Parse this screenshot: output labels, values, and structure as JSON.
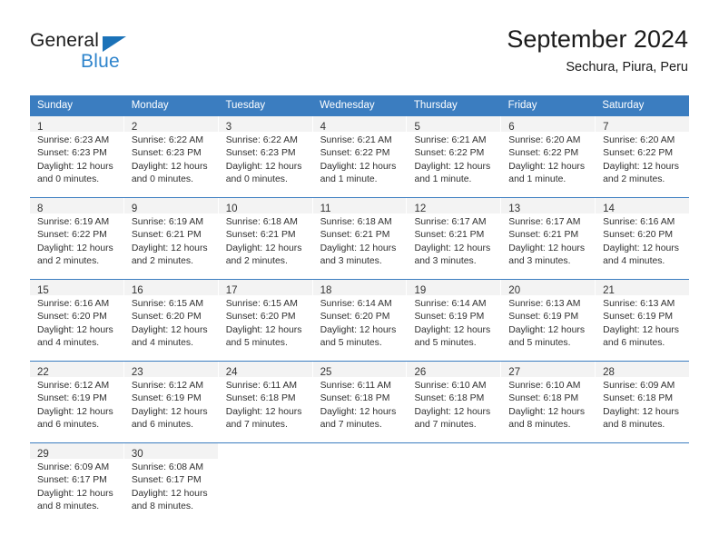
{
  "brand": {
    "name_top": "General",
    "name_bottom": "Blue",
    "accent_color": "#2e84cc",
    "triangle_color": "#1b72b8"
  },
  "header": {
    "title": "September 2024",
    "subtitle": "Sechura, Piura, Peru"
  },
  "theme": {
    "header_row_bg": "#3b7dc0",
    "header_row_text": "#ffffff",
    "daynum_band_bg": "#f3f3f3",
    "week_border": "#3b7dc0"
  },
  "weekdays": [
    "Sunday",
    "Monday",
    "Tuesday",
    "Wednesday",
    "Thursday",
    "Friday",
    "Saturday"
  ],
  "weeks": [
    [
      {
        "day": "1",
        "sunrise": "Sunrise: 6:23 AM",
        "sunset": "Sunset: 6:23 PM",
        "daylight1": "Daylight: 12 hours",
        "daylight2": "and 0 minutes."
      },
      {
        "day": "2",
        "sunrise": "Sunrise: 6:22 AM",
        "sunset": "Sunset: 6:23 PM",
        "daylight1": "Daylight: 12 hours",
        "daylight2": "and 0 minutes."
      },
      {
        "day": "3",
        "sunrise": "Sunrise: 6:22 AM",
        "sunset": "Sunset: 6:23 PM",
        "daylight1": "Daylight: 12 hours",
        "daylight2": "and 0 minutes."
      },
      {
        "day": "4",
        "sunrise": "Sunrise: 6:21 AM",
        "sunset": "Sunset: 6:22 PM",
        "daylight1": "Daylight: 12 hours",
        "daylight2": "and 1 minute."
      },
      {
        "day": "5",
        "sunrise": "Sunrise: 6:21 AM",
        "sunset": "Sunset: 6:22 PM",
        "daylight1": "Daylight: 12 hours",
        "daylight2": "and 1 minute."
      },
      {
        "day": "6",
        "sunrise": "Sunrise: 6:20 AM",
        "sunset": "Sunset: 6:22 PM",
        "daylight1": "Daylight: 12 hours",
        "daylight2": "and 1 minute."
      },
      {
        "day": "7",
        "sunrise": "Sunrise: 6:20 AM",
        "sunset": "Sunset: 6:22 PM",
        "daylight1": "Daylight: 12 hours",
        "daylight2": "and 2 minutes."
      }
    ],
    [
      {
        "day": "8",
        "sunrise": "Sunrise: 6:19 AM",
        "sunset": "Sunset: 6:22 PM",
        "daylight1": "Daylight: 12 hours",
        "daylight2": "and 2 minutes."
      },
      {
        "day": "9",
        "sunrise": "Sunrise: 6:19 AM",
        "sunset": "Sunset: 6:21 PM",
        "daylight1": "Daylight: 12 hours",
        "daylight2": "and 2 minutes."
      },
      {
        "day": "10",
        "sunrise": "Sunrise: 6:18 AM",
        "sunset": "Sunset: 6:21 PM",
        "daylight1": "Daylight: 12 hours",
        "daylight2": "and 2 minutes."
      },
      {
        "day": "11",
        "sunrise": "Sunrise: 6:18 AM",
        "sunset": "Sunset: 6:21 PM",
        "daylight1": "Daylight: 12 hours",
        "daylight2": "and 3 minutes."
      },
      {
        "day": "12",
        "sunrise": "Sunrise: 6:17 AM",
        "sunset": "Sunset: 6:21 PM",
        "daylight1": "Daylight: 12 hours",
        "daylight2": "and 3 minutes."
      },
      {
        "day": "13",
        "sunrise": "Sunrise: 6:17 AM",
        "sunset": "Sunset: 6:21 PM",
        "daylight1": "Daylight: 12 hours",
        "daylight2": "and 3 minutes."
      },
      {
        "day": "14",
        "sunrise": "Sunrise: 6:16 AM",
        "sunset": "Sunset: 6:20 PM",
        "daylight1": "Daylight: 12 hours",
        "daylight2": "and 4 minutes."
      }
    ],
    [
      {
        "day": "15",
        "sunrise": "Sunrise: 6:16 AM",
        "sunset": "Sunset: 6:20 PM",
        "daylight1": "Daylight: 12 hours",
        "daylight2": "and 4 minutes."
      },
      {
        "day": "16",
        "sunrise": "Sunrise: 6:15 AM",
        "sunset": "Sunset: 6:20 PM",
        "daylight1": "Daylight: 12 hours",
        "daylight2": "and 4 minutes."
      },
      {
        "day": "17",
        "sunrise": "Sunrise: 6:15 AM",
        "sunset": "Sunset: 6:20 PM",
        "daylight1": "Daylight: 12 hours",
        "daylight2": "and 5 minutes."
      },
      {
        "day": "18",
        "sunrise": "Sunrise: 6:14 AM",
        "sunset": "Sunset: 6:20 PM",
        "daylight1": "Daylight: 12 hours",
        "daylight2": "and 5 minutes."
      },
      {
        "day": "19",
        "sunrise": "Sunrise: 6:14 AM",
        "sunset": "Sunset: 6:19 PM",
        "daylight1": "Daylight: 12 hours",
        "daylight2": "and 5 minutes."
      },
      {
        "day": "20",
        "sunrise": "Sunrise: 6:13 AM",
        "sunset": "Sunset: 6:19 PM",
        "daylight1": "Daylight: 12 hours",
        "daylight2": "and 5 minutes."
      },
      {
        "day": "21",
        "sunrise": "Sunrise: 6:13 AM",
        "sunset": "Sunset: 6:19 PM",
        "daylight1": "Daylight: 12 hours",
        "daylight2": "and 6 minutes."
      }
    ],
    [
      {
        "day": "22",
        "sunrise": "Sunrise: 6:12 AM",
        "sunset": "Sunset: 6:19 PM",
        "daylight1": "Daylight: 12 hours",
        "daylight2": "and 6 minutes."
      },
      {
        "day": "23",
        "sunrise": "Sunrise: 6:12 AM",
        "sunset": "Sunset: 6:19 PM",
        "daylight1": "Daylight: 12 hours",
        "daylight2": "and 6 minutes."
      },
      {
        "day": "24",
        "sunrise": "Sunrise: 6:11 AM",
        "sunset": "Sunset: 6:18 PM",
        "daylight1": "Daylight: 12 hours",
        "daylight2": "and 7 minutes."
      },
      {
        "day": "25",
        "sunrise": "Sunrise: 6:11 AM",
        "sunset": "Sunset: 6:18 PM",
        "daylight1": "Daylight: 12 hours",
        "daylight2": "and 7 minutes."
      },
      {
        "day": "26",
        "sunrise": "Sunrise: 6:10 AM",
        "sunset": "Sunset: 6:18 PM",
        "daylight1": "Daylight: 12 hours",
        "daylight2": "and 7 minutes."
      },
      {
        "day": "27",
        "sunrise": "Sunrise: 6:10 AM",
        "sunset": "Sunset: 6:18 PM",
        "daylight1": "Daylight: 12 hours",
        "daylight2": "and 8 minutes."
      },
      {
        "day": "28",
        "sunrise": "Sunrise: 6:09 AM",
        "sunset": "Sunset: 6:18 PM",
        "daylight1": "Daylight: 12 hours",
        "daylight2": "and 8 minutes."
      }
    ],
    [
      {
        "day": "29",
        "sunrise": "Sunrise: 6:09 AM",
        "sunset": "Sunset: 6:17 PM",
        "daylight1": "Daylight: 12 hours",
        "daylight2": "and 8 minutes."
      },
      {
        "day": "30",
        "sunrise": "Sunrise: 6:08 AM",
        "sunset": "Sunset: 6:17 PM",
        "daylight1": "Daylight: 12 hours",
        "daylight2": "and 8 minutes."
      },
      {
        "day": "",
        "sunrise": "",
        "sunset": "",
        "daylight1": "",
        "daylight2": ""
      },
      {
        "day": "",
        "sunrise": "",
        "sunset": "",
        "daylight1": "",
        "daylight2": ""
      },
      {
        "day": "",
        "sunrise": "",
        "sunset": "",
        "daylight1": "",
        "daylight2": ""
      },
      {
        "day": "",
        "sunrise": "",
        "sunset": "",
        "daylight1": "",
        "daylight2": ""
      },
      {
        "day": "",
        "sunrise": "",
        "sunset": "",
        "daylight1": "",
        "daylight2": ""
      }
    ]
  ]
}
